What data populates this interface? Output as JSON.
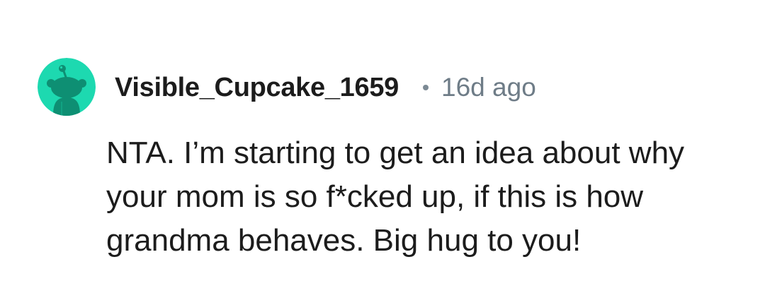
{
  "comment": {
    "username": "Visible_Cupcake_1659",
    "separator": "•",
    "timestamp": "16d ago",
    "text": "NTA. I’m starting to get an idea about why your mom is so f*cked up, if this is how grandma behaves. Big hug to you!",
    "avatar_icon": "reddit-snoo-avatar-icon",
    "avatar_color": "#1DD9B0"
  }
}
